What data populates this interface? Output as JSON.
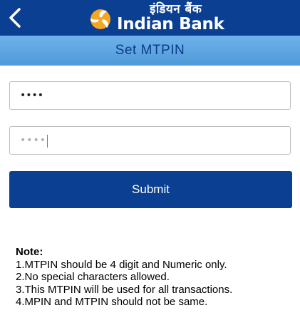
{
  "header": {
    "back_icon": "chevron-left-icon",
    "logo_icon": "indian-bank-emblem-icon",
    "logo_hindi": "इंडियन बैंक",
    "logo_english": "Indian Bank"
  },
  "page": {
    "title": "Set MTPIN"
  },
  "form": {
    "mtpin_value": "••••",
    "confirm_placeholder": "••••",
    "submit_label": "Submit"
  },
  "note": {
    "title": "Note:",
    "items": [
      "1.MTPIN should be 4 digit and Numeric only.",
      "2.No special characters allowed.",
      "3.This MTPIN will be used for all transactions.",
      "4.MPIN and MTPIN should not be same."
    ]
  },
  "colors": {
    "header_bg": "#0b3f92",
    "titlebar_bg": "#5aa4e0",
    "button_bg": "#0b3f92",
    "logo_accent": "#f5a623"
  }
}
